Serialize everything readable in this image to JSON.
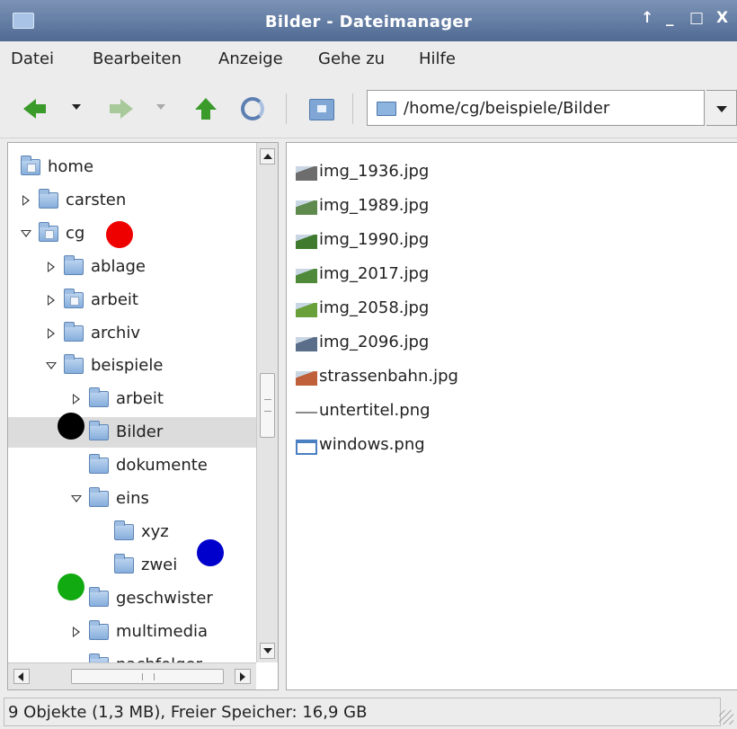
{
  "window": {
    "title": "Bilder - Dateimanager",
    "controls": [
      "↑",
      "_",
      "□",
      "X"
    ]
  },
  "menu": [
    "Datei",
    "Bearbeiten",
    "Anzeige",
    "Gehe zu",
    "Hilfe"
  ],
  "toolbar": {
    "path": "/home/cg/beispiele/Bilder"
  },
  "tree": [
    {
      "label": "home",
      "depth": 0,
      "expander": "none",
      "icon": "home-folder-icon"
    },
    {
      "label": "carsten",
      "depth": 0,
      "expander": "closed",
      "icon": "folder-icon"
    },
    {
      "label": "cg",
      "depth": 0,
      "expander": "open",
      "icon": "home-folder-icon"
    },
    {
      "label": "ablage",
      "depth": 1,
      "expander": "closed",
      "icon": "folder-icon"
    },
    {
      "label": "arbeit",
      "depth": 1,
      "expander": "closed",
      "icon": "document-folder-icon"
    },
    {
      "label": "archiv",
      "depth": 1,
      "expander": "closed",
      "icon": "folder-icon"
    },
    {
      "label": "beispiele",
      "depth": 1,
      "expander": "open",
      "icon": "folder-icon"
    },
    {
      "label": "arbeit",
      "depth": 2,
      "expander": "closed",
      "icon": "folder-icon"
    },
    {
      "label": "Bilder",
      "depth": 2,
      "expander": "none",
      "icon": "folder-icon",
      "selected": true
    },
    {
      "label": "dokumente",
      "depth": 2,
      "expander": "none",
      "icon": "folder-icon"
    },
    {
      "label": "eins",
      "depth": 2,
      "expander": "open",
      "icon": "folder-icon"
    },
    {
      "label": "xyz",
      "depth": 3,
      "expander": "none",
      "icon": "folder-icon"
    },
    {
      "label": "zwei",
      "depth": 3,
      "expander": "none",
      "icon": "folder-icon"
    },
    {
      "label": "geschwister",
      "depth": 2,
      "expander": "none",
      "icon": "folder-icon"
    },
    {
      "label": "multimedia",
      "depth": 2,
      "expander": "closed",
      "icon": "folder-icon"
    },
    {
      "label": "nachfolger",
      "depth": 2,
      "expander": "none",
      "icon": "folder-icon"
    }
  ],
  "files": [
    {
      "name": "img_1936.jpg",
      "icon": "photo-thumbnail-icon",
      "color": "#6d6d6d"
    },
    {
      "name": "img_1989.jpg",
      "icon": "photo-thumbnail-icon",
      "color": "#5e8a4e"
    },
    {
      "name": "img_1990.jpg",
      "icon": "photo-thumbnail-icon",
      "color": "#3f7a2e"
    },
    {
      "name": "img_2017.jpg",
      "icon": "photo-thumbnail-icon",
      "color": "#4e8a3a"
    },
    {
      "name": "img_2058.jpg",
      "icon": "photo-thumbnail-icon",
      "color": "#6aa03a"
    },
    {
      "name": "img_2096.jpg",
      "icon": "photo-thumbnail-icon",
      "color": "#5a6e8a"
    },
    {
      "name": "strassenbahn.jpg",
      "icon": "photo-thumbnail-icon",
      "color": "#c0603a"
    },
    {
      "name": "untertitel.png",
      "icon": "line-image-icon",
      "color": "#8a8a8a"
    },
    {
      "name": "windows.png",
      "icon": "window-image-icon",
      "color": "#4a7fc1"
    }
  ],
  "status": "9 Objekte (1,3 MB), Freier Speicher: 16,9 GB",
  "markers": [
    {
      "name": "red-marker",
      "color": "#ee0000"
    },
    {
      "name": "black-marker",
      "color": "#000000"
    },
    {
      "name": "blue-marker",
      "color": "#0000cc"
    },
    {
      "name": "green-marker",
      "color": "#11aa11"
    }
  ]
}
